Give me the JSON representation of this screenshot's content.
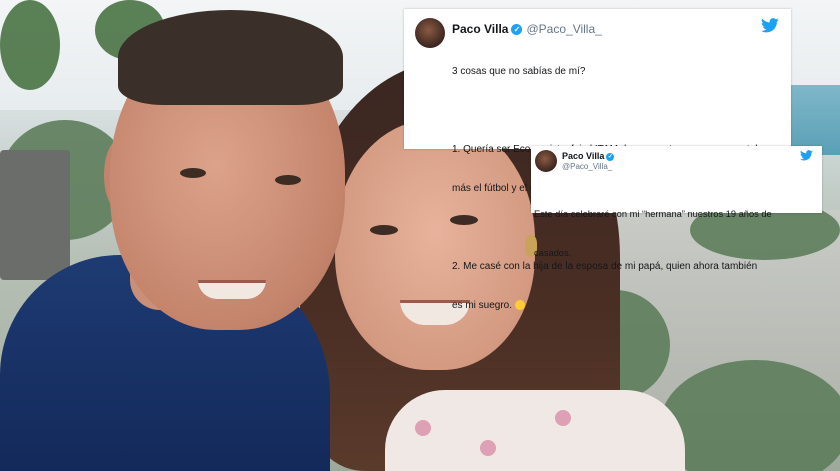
{
  "tweets": [
    {
      "name": "Paco Villa",
      "verified_glyph": "✓",
      "handle": "@Paco_Villa_",
      "icon": "twitter-bird-icon",
      "lines": [
        "3 cosas que no sabías de mí?",
        "",
        "1. Quería ser Economista, fui al ITAM dos semestres, pero me gustaba",
        "más el fútbol y el dominó que la ley de la oferta y la demanda.",
        "",
        "2. Me casé con la hija de la esposa de mi papá, quien ahora también",
        "es mi suegro. "
      ],
      "emoji": "rofl-emoji"
    },
    {
      "name": "Paco Villa",
      "verified_glyph": "✓",
      "handle": "@Paco_Villa_",
      "icon": "twitter-bird-icon",
      "lines": [
        "Este día celebraré con mi “hermana” nuestros 19 años de",
        "casados."
      ]
    }
  ],
  "colors": {
    "twitter_blue": "#1da1f2",
    "shirt_blue": "#1e3b73"
  }
}
